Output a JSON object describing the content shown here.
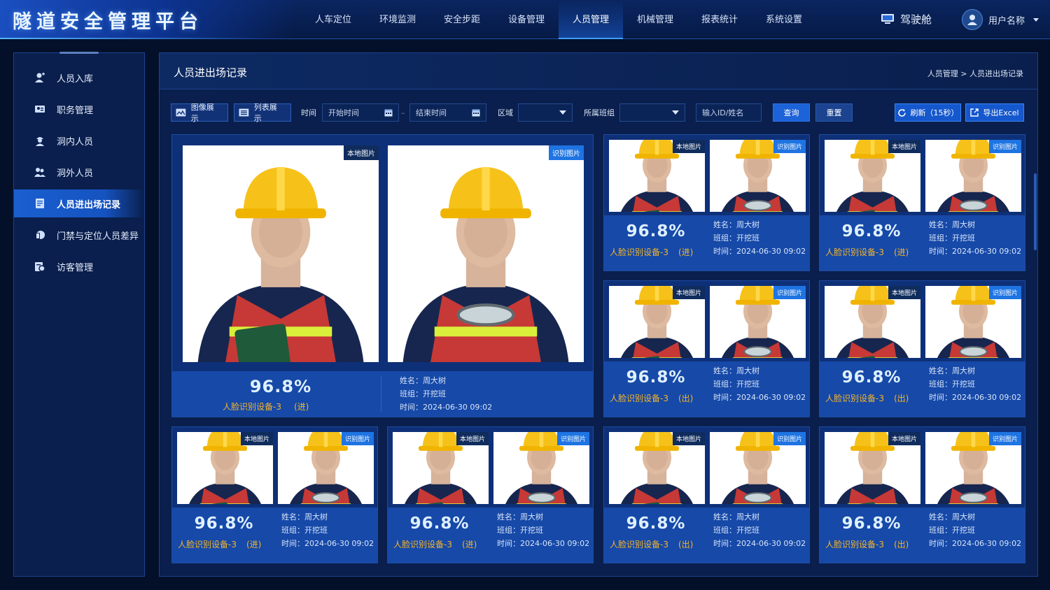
{
  "app": {
    "title": "隧道安全管理平台"
  },
  "nav": [
    {
      "label": "人车定位"
    },
    {
      "label": "环境监测"
    },
    {
      "label": "安全步距"
    },
    {
      "label": "设备管理"
    },
    {
      "label": "人员管理"
    },
    {
      "label": "机械管理"
    },
    {
      "label": "报表统计"
    },
    {
      "label": "系统设置"
    }
  ],
  "header": {
    "driver": "驾驶舱",
    "user": "用户名称"
  },
  "sidebar": {
    "items": [
      {
        "label": "人员入库"
      },
      {
        "label": "职务管理"
      },
      {
        "label": "洞内人员"
      },
      {
        "label": "洞外人员"
      },
      {
        "label": "人员进出场记录"
      },
      {
        "label": "门禁与定位人员差异"
      },
      {
        "label": "访客管理"
      }
    ]
  },
  "panel": {
    "title": "人员进出场记录",
    "breadcrumb": "人员管理 > 人员进出场记录"
  },
  "toolbar": {
    "image_view": "图像展示",
    "list_view": "列表展示",
    "time_label": "时间",
    "start_placeholder": "开始时间",
    "end_placeholder": "结束时间",
    "area_label": "区域",
    "team_label": "所属班组",
    "search_placeholder": "输入ID/姓名",
    "query": "查询",
    "reset": "重置",
    "refresh": "刷新（15秒）",
    "export": "导出Excel"
  },
  "labels": {
    "local": "本地图片",
    "recog": "识别图片"
  },
  "records": [
    {
      "score": "96.8%",
      "device": "人脸识别设备-3",
      "dir": "(进)",
      "name": "姓名：周大树",
      "team": "班组：开挖班",
      "time": "时间：2024-06-30 09:02"
    },
    {
      "score": "96.8%",
      "device": "人脸识别设备-3",
      "dir": "(进)",
      "name": "姓名：周大树",
      "team": "班组：开挖班",
      "time": "时间：2024-06-30 09:02"
    },
    {
      "score": "96.8%",
      "device": "人脸识别设备-3",
      "dir": "(进)",
      "name": "姓名：周大树",
      "team": "班组：开挖班",
      "time": "时间：2024-06-30 09:02"
    },
    {
      "score": "96.8%",
      "device": "人脸识别设备-3",
      "dir": "(出)",
      "name": "姓名：周大树",
      "team": "班组：开挖班",
      "time": "时间：2024-06-30 09:02"
    },
    {
      "score": "96.8%",
      "device": "人脸识别设备-3",
      "dir": "(出)",
      "name": "姓名：周大树",
      "team": "班组：开挖班",
      "time": "时间：2024-06-30 09:02"
    },
    {
      "score": "96.8%",
      "device": "人脸识别设备-3",
      "dir": "(进)",
      "name": "姓名：周大树",
      "team": "班组：开挖班",
      "time": "时间：2024-06-30 09:02"
    },
    {
      "score": "96.8%",
      "device": "人脸识别设备-3",
      "dir": "(进)",
      "name": "姓名：周大树",
      "team": "班组：开挖班",
      "time": "时间：2024-06-30 09:02"
    },
    {
      "score": "96.8%",
      "device": "人脸识别设备-3",
      "dir": "(出)",
      "name": "姓名：周大树",
      "team": "班组：开挖班",
      "time": "时间：2024-06-30 09:02"
    },
    {
      "score": "96.8%",
      "device": "人脸识别设备-3",
      "dir": "(出)",
      "name": "姓名：周大树",
      "team": "班组：开挖班",
      "time": "时间：2024-06-30 09:02"
    }
  ],
  "colors": {
    "accent": "#1c62d8",
    "device_text": "#f4b52a",
    "helmet": "#f6c21a",
    "vest": "#d63b34"
  }
}
